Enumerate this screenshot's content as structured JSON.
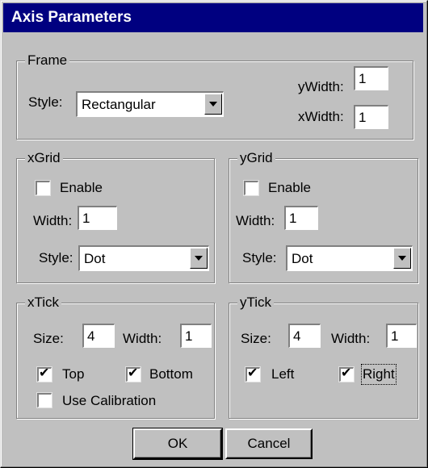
{
  "title": "Axis Parameters",
  "frame": {
    "label": "Frame",
    "style_label": "Style:",
    "style_value": "Rectangular",
    "ywidth_label": "yWidth:",
    "ywidth_value": "1",
    "xwidth_label": "xWidth:",
    "xwidth_value": "1"
  },
  "xgrid": {
    "label": "xGrid",
    "enable_label": "Enable",
    "enable_checked": false,
    "width_label": "Width:",
    "width_value": "1",
    "style_label": "Style:",
    "style_value": "Dot"
  },
  "ygrid": {
    "label": "yGrid",
    "enable_label": "Enable",
    "enable_checked": false,
    "width_label": "Width:",
    "width_value": "1",
    "style_label": "Style:",
    "style_value": "Dot"
  },
  "xtick": {
    "label": "xTick",
    "size_label": "Size:",
    "size_value": "4",
    "width_label": "Width:",
    "width_value": "1",
    "top_label": "Top",
    "top_checked": true,
    "bottom_label": "Bottom",
    "bottom_checked": true,
    "calibration_label": "Use Calibration",
    "calibration_checked": false
  },
  "ytick": {
    "label": "yTick",
    "size_label": "Size:",
    "size_value": "4",
    "width_label": "Width:",
    "width_value": "1",
    "left_label": "Left",
    "left_checked": true,
    "right_label": "Right",
    "right_checked": true
  },
  "buttons": {
    "ok": "OK",
    "cancel": "Cancel"
  }
}
